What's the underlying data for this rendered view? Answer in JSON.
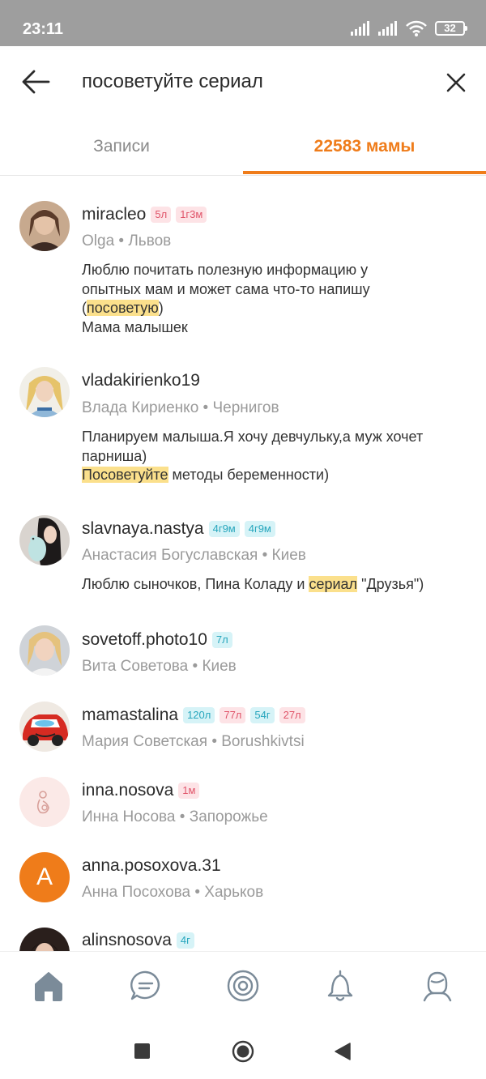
{
  "status_bar": {
    "time": "23:11",
    "battery": "32"
  },
  "search": {
    "query": "посоветуйте сериал"
  },
  "tabs": {
    "posts": "Записи",
    "moms": "22583 мамы"
  },
  "results": [
    {
      "username": "miracleo",
      "badges": [
        {
          "text": "5л",
          "color": "pink"
        },
        {
          "text": "1г3м",
          "color": "pink"
        }
      ],
      "meta": "Olga • Львов",
      "bio_lines": [
        {
          "pre": "Люблю почитать полезную информацию у",
          "hl": "",
          "post": ""
        },
        {
          "pre": "опытных мам и может сама что-то напишу",
          "hl": "",
          "post": ""
        },
        {
          "pre": "(",
          "hl": "посоветую",
          "post": ")"
        },
        {
          "pre": "Мама малышек",
          "hl": "",
          "post": ""
        }
      ]
    },
    {
      "username": "vladakirienko19",
      "badges": [],
      "meta": "Влада Кириенко • Чернигов",
      "bio_lines": [
        {
          "pre": "Планируем малыша.Я хочу девчульку,а муж хочет",
          "hl": "",
          "post": ""
        },
        {
          "pre": "парниша)",
          "hl": "",
          "post": ""
        },
        {
          "pre": "",
          "hl": "Посоветуйте",
          "post": " методы беременности)"
        }
      ]
    },
    {
      "username": "slavnaya.nastya",
      "badges": [
        {
          "text": "4г9м",
          "color": "cyan"
        },
        {
          "text": "4г9м",
          "color": "cyan"
        }
      ],
      "meta": "Анастасия Богуславская  • Киев",
      "bio_lines": [
        {
          "pre": "Люблю сыночков, Пина Коладу и ",
          "hl": "сериал",
          "post": " \"Друзья\")"
        }
      ]
    },
    {
      "username": "sovetoff.photo10",
      "badges": [
        {
          "text": "7л",
          "color": "cyan"
        }
      ],
      "meta": "Вита Советова • Киев",
      "bio_lines": []
    },
    {
      "username": "mamastalina",
      "badges": [
        {
          "text": "120л",
          "color": "cyan"
        },
        {
          "text": "77л",
          "color": "pink"
        },
        {
          "text": "54г",
          "color": "cyan"
        },
        {
          "text": "27л",
          "color": "pink"
        }
      ],
      "meta": "Мария Советская • Borushkivtsi",
      "bio_lines": []
    },
    {
      "username": "inna.nosova",
      "badges": [
        {
          "text": "1м",
          "color": "pink"
        }
      ],
      "meta": "Инна Носова • Запорожье",
      "bio_lines": []
    },
    {
      "username": "anna.posoxova.31",
      "avatar_letter": "A",
      "badges": [],
      "meta": "Анна Посохова • Харьков",
      "bio_lines": []
    },
    {
      "username": "alinsnosova",
      "badges": [
        {
          "text": "4г",
          "color": "cyan"
        }
      ],
      "meta": "",
      "bio_lines": []
    }
  ],
  "bottom_nav": [
    "home-icon",
    "chat-icon",
    "target-icon",
    "bell-icon",
    "profile-icon"
  ],
  "colors": {
    "accent": "#ef7c1a",
    "highlight": "#fbe08c",
    "badge_pink": "#e0556a",
    "badge_cyan": "#27a6bd"
  }
}
